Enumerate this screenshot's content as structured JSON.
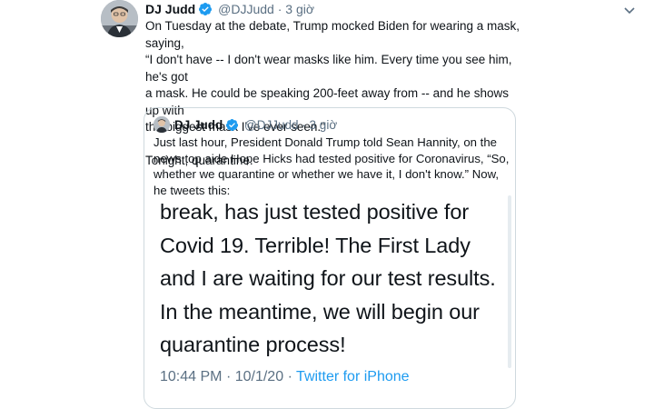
{
  "tweet": {
    "author_name": "DJ Judd",
    "author_handle": "@DJJudd",
    "separator": "·",
    "time": "3 giờ",
    "text": "On Tuesday at the debate, Trump mocked Biden for wearing a mask, saying,\n“I don't have -- I don't wear masks like him. Every time you see him, he's got\na mask. He could be speaking 200-feet away from -- and he shows up with\nthe biggest mask I've ever seen.”\n\nTonight, quarantine."
  },
  "quoted_tweet": {
    "author_name": "DJ Judd",
    "author_handle": "@DJJudd",
    "separator": "·",
    "time": "3 giờ",
    "text": "Just last hour, President Donald Trump told Sean Hannity, on the news top aide Hope Hicks had tested positive for Coronavirus, “So, whether we quarantine or whether we have it, I don't know.” Now, he tweets this:",
    "embed": {
      "text": "break, has just tested positive for Covid 19. Terrible! The First Lady and I are waiting for our test results. In the meantime, we will begin our quarantine process!",
      "time": "10:44 PM",
      "separator": "·",
      "date": "10/1/20",
      "source": "Twitter for iPhone"
    }
  },
  "icons": {
    "verified": "verified-badge-icon",
    "menu": "chevron-down-icon",
    "avatar": "profile-avatar"
  },
  "colors": {
    "text": "#0f1419",
    "secondary": "#5b7083",
    "verified": "#1d9bf0",
    "link": "#1d9bf0",
    "border": "#cfd9de"
  }
}
